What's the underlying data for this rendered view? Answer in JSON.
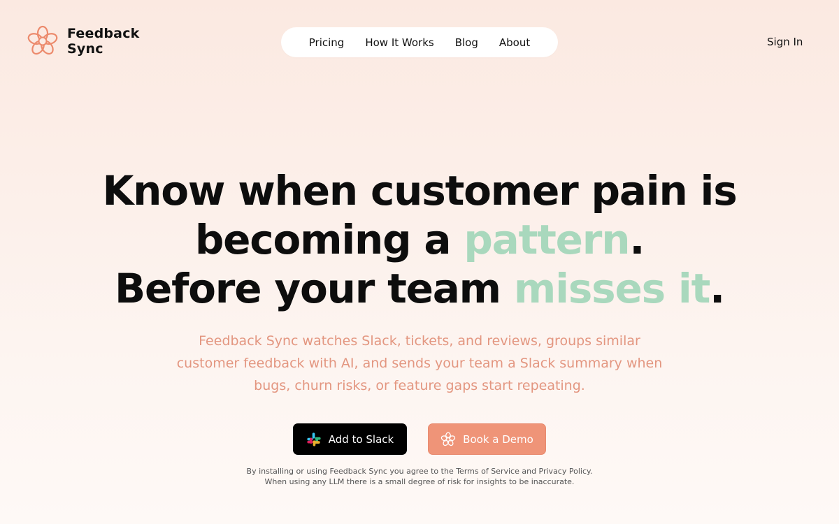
{
  "brand": {
    "name_line1": "Feedback",
    "name_line2": "Sync",
    "logo_icon": "flower-icon"
  },
  "nav": {
    "items": [
      {
        "label": "Pricing"
      },
      {
        "label": "How It Works"
      },
      {
        "label": "Blog"
      },
      {
        "label": "About"
      }
    ],
    "sign_in": "Sign In"
  },
  "hero": {
    "line1": "Know when customer pain is",
    "line2_prefix": "becoming a ",
    "line2_accent": "pattern",
    "line2_suffix": ".",
    "line3_prefix": "Before your team ",
    "line3_accent": "misses it",
    "line3_suffix": ".",
    "subtitle": "Feedback Sync watches Slack, tickets, and reviews, groups similar customer feedback with AI, and sends your team a Slack summary when bugs, churn risks, or feature gaps start repeating."
  },
  "cta": {
    "slack_label": "Add to Slack",
    "slack_icon": "slack-icon",
    "demo_label": "Book a Demo",
    "demo_icon": "flower-icon"
  },
  "disclaimer": {
    "line1": "By installing or using Feedback Sync you agree to the Terms of Service and Privacy Policy.",
    "line2": "When using any LLM there is a small degree of risk for insights to be inaccurate."
  },
  "colors": {
    "accent_green": "#a9d8bd",
    "subtitle_coral": "#e39680",
    "demo_button": "#ef9478",
    "slack_button": "#000000"
  }
}
